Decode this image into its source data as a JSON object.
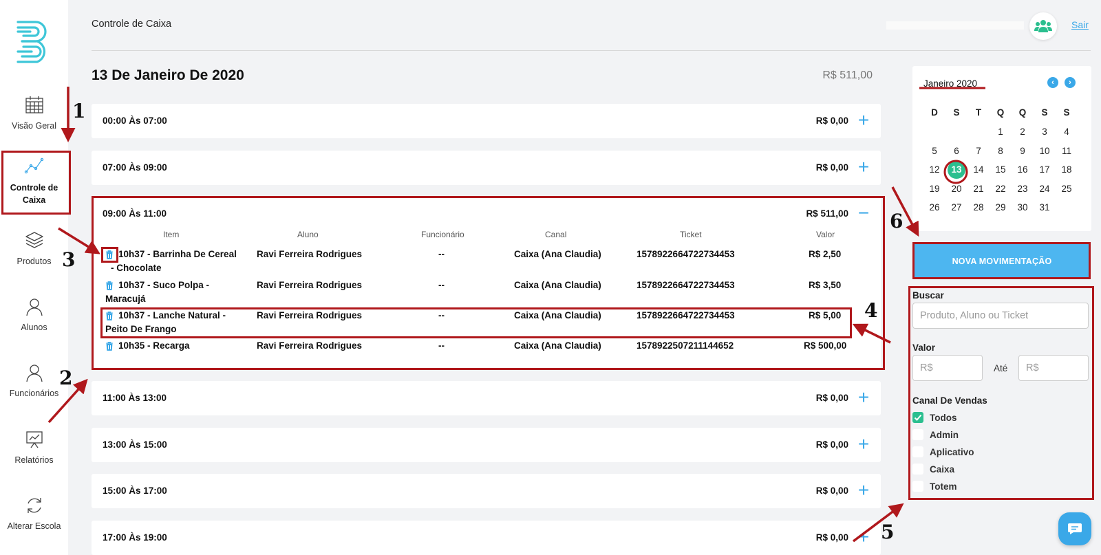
{
  "header": {
    "title": "Controle de Caixa",
    "logout": "Sair"
  },
  "sidebar": {
    "items": [
      {
        "label": "Visão Geral",
        "icon": "calendar-icon"
      },
      {
        "label": "Controle de Caixa",
        "icon": "chart-line-icon",
        "active": true
      },
      {
        "label": "Produtos",
        "icon": "layers-icon"
      },
      {
        "label": "Alunos",
        "icon": "user-icon"
      },
      {
        "label": "Funcionários",
        "icon": "user-icon"
      },
      {
        "label": "Relatórios",
        "icon": "presentation-icon"
      },
      {
        "label": "Alterar Escola",
        "icon": "refresh-icon"
      }
    ]
  },
  "main": {
    "date_title": "13 De Janeiro De 2020",
    "day_total": "R$ 511,00",
    "slots": [
      {
        "label": "00:00 Às 07:00",
        "total": "R$ 0,00",
        "toggle": "+"
      },
      {
        "label": "07:00 Às 09:00",
        "total": "R$ 0,00",
        "toggle": "+"
      },
      {
        "label": "09:00 Às 11:00",
        "total": "R$ 511,00",
        "toggle": "−"
      },
      {
        "label": "11:00 Às 13:00",
        "total": "R$ 0,00",
        "toggle": "+"
      },
      {
        "label": "13:00 Às 15:00",
        "total": "R$ 0,00",
        "toggle": "+"
      },
      {
        "label": "15:00 Às 17:00",
        "total": "R$ 0,00",
        "toggle": "+"
      },
      {
        "label": "17:00 Às 19:00",
        "total": "R$ 0,00",
        "toggle": "+"
      }
    ],
    "table_headers": [
      "Item",
      "Aluno",
      "Funcionário",
      "Canal",
      "Ticket",
      "Valor"
    ],
    "transactions": [
      {
        "item_line1": "10h37 - Barrinha De Cereal",
        "item_line2": "- Chocolate",
        "aluno": "Ravi Ferreira Rodrigues",
        "funcionario": "--",
        "canal": "Caixa (Ana Claudia)",
        "ticket": "1578922664722734453",
        "valor": "R$ 2,50"
      },
      {
        "item_line1": "10h37 - Suco Polpa -",
        "item_line2": "Maracujá",
        "aluno": "Ravi Ferreira Rodrigues",
        "funcionario": "--",
        "canal": "Caixa (Ana Claudia)",
        "ticket": "1578922664722734453",
        "valor": "R$ 3,50"
      },
      {
        "item_line1": "10h37 - Lanche Natural -",
        "item_line2": "Peito De Frango",
        "aluno": "Ravi Ferreira Rodrigues",
        "funcionario": "--",
        "canal": "Caixa (Ana Claudia)",
        "ticket": "1578922664722734453",
        "valor": "R$ 5,00"
      },
      {
        "item_line1": "10h35 - Recarga",
        "item_line2": "",
        "aluno": "Ravi Ferreira Rodrigues",
        "funcionario": "--",
        "canal": "Caixa (Ana Claudia)",
        "ticket": "1578922507211144652",
        "valor": "R$ 500,00"
      }
    ]
  },
  "calendar": {
    "month": "Janeiro 2020",
    "prev": "‹",
    "next": "›",
    "weekdays": [
      "D",
      "S",
      "T",
      "Q",
      "Q",
      "S",
      "S"
    ],
    "selected_day": 13,
    "first_weekday": 3,
    "days_in_month": 31
  },
  "actions": {
    "new_movement": "NOVA MOVIMENTAÇÃO"
  },
  "filters": {
    "search_label": "Buscar",
    "search_placeholder": "Produto, Aluno ou Ticket",
    "value_label": "Valor",
    "value_min_placeholder": "R$",
    "value_max_placeholder": "R$",
    "value_between": "Até",
    "channel_label": "Canal De Vendas",
    "channels": [
      {
        "label": "Todos",
        "checked": true
      },
      {
        "label": "Admin",
        "checked": false
      },
      {
        "label": "Aplicativo",
        "checked": false
      },
      {
        "label": "Caixa",
        "checked": false
      },
      {
        "label": "Totem",
        "checked": false
      }
    ]
  },
  "annotations": [
    "1",
    "2",
    "3",
    "4",
    "5",
    "6"
  ],
  "colors": {
    "accent": "#3aa8e8",
    "success": "#2bbf8f",
    "annotation": "#b0181c",
    "background": "#f2f3f5"
  }
}
